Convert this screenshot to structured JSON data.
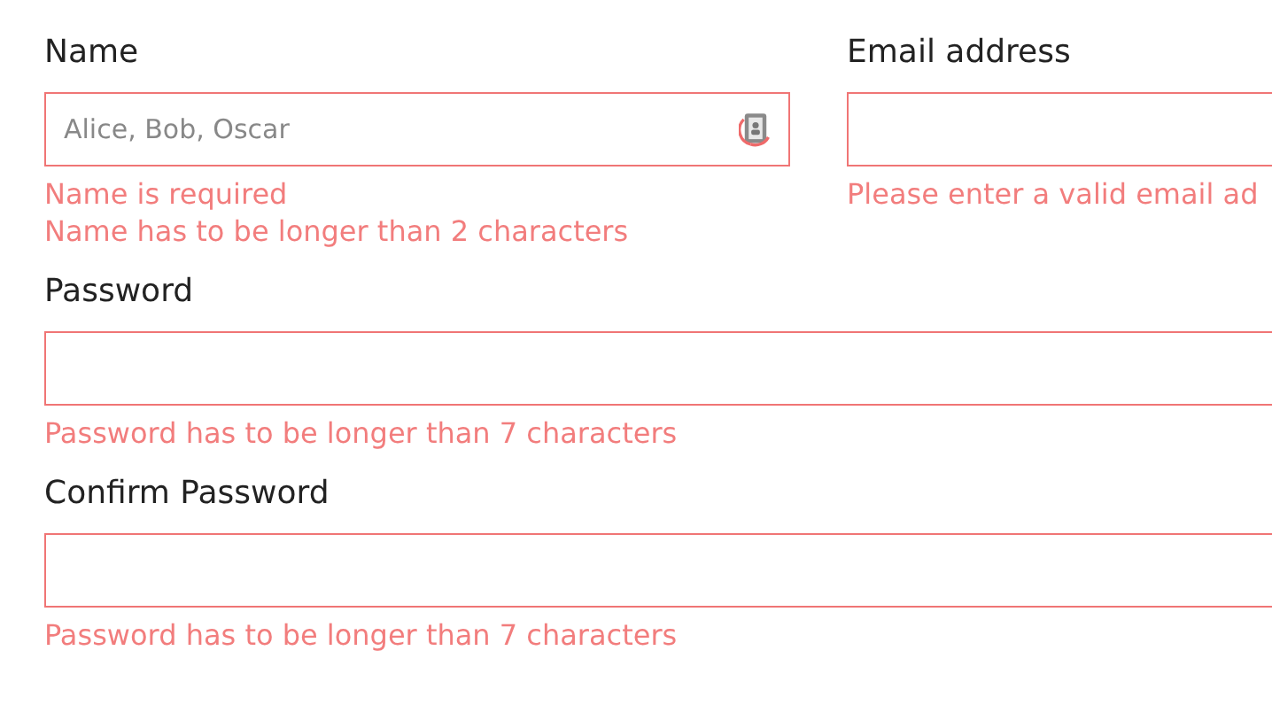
{
  "rows": [
    [
      {
        "kind": "picker",
        "label": "Name",
        "placeholder": "Alice, Bob, Oscar",
        "errors": [
          "Name is required",
          "Name has to be longer than 2 characters"
        ]
      },
      {
        "kind": "text",
        "label": "Email address",
        "errors": [
          "Please enter a valid email ad"
        ]
      }
    ],
    [
      {
        "kind": "text",
        "label": "Password",
        "errors": [
          "Password has to be longer than 7 characters"
        ]
      }
    ],
    [
      {
        "kind": "text",
        "label": "Confirm Password",
        "errors": [
          "Password has to be longer than 7 characters"
        ]
      }
    ]
  ]
}
